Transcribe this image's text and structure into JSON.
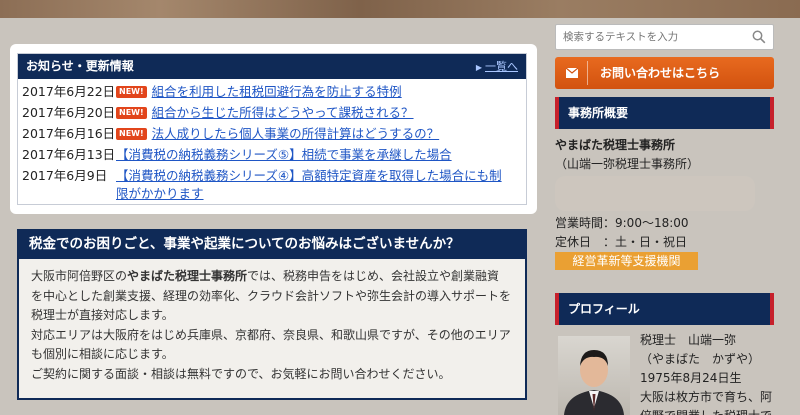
{
  "news": {
    "title": "お知らせ・更新情報",
    "more_label": "一覧へ",
    "new_badge": "NEW!",
    "items": [
      {
        "date": "2017年6月22日",
        "is_new": true,
        "title": "組合を利用した租税回避行為を防止する特例"
      },
      {
        "date": "2017年6月20日",
        "is_new": true,
        "title": "組合から生じた所得はどうやって課税される？"
      },
      {
        "date": "2017年6月16日",
        "is_new": true,
        "title": "法人成りしたら個人事業の所得計算はどうするの？"
      },
      {
        "date": "2017年6月13日",
        "is_new": false,
        "title": "【消費税の納税義務シリーズ⑤】相続で事業を承継した場合"
      },
      {
        "date": "2017年6月9日",
        "is_new": false,
        "title": "【消費税の納税義務シリーズ④】高額特定資産を取得した場合にも制限がかかります"
      }
    ]
  },
  "consult": {
    "heading": "税金でのお困りごと、事業や起業についてのお悩みはございませんか？",
    "p1_prefix": "大阪市阿倍野区の",
    "p1_bold": "やまばた税理士事務所",
    "p1_rest": "では、税務申告をはじめ、会社設立や創業融資を中心とした創業支援、経理の効率化、クラウド会計ソフトや弥生会計の導入サポートを税理士が直接対応します。",
    "p2": "対応エリアは大阪府をはじめ兵庫県、京都府、奈良県、和歌山県ですが、その他のエリアも個別に相談に応じます。",
    "p3": "ご契約に関する面談・相談は無料ですので、お気軽にお問い合わせください。"
  },
  "sidebar": {
    "search_placeholder": "検索するテキストを入力",
    "contact_label": "お問い合わせはこちら",
    "office_heading": "事務所概要",
    "office_name": "やまばた税理士事務所",
    "office_sub": "（山端一弥税理士事務所）",
    "hours": "営業時間：9:00〜18:00",
    "holidays": "定休日　：土・日・祝日",
    "support_label": "経営革新等支援機関",
    "profile_heading": "プロフィール",
    "profile_lines": [
      "税理士　山端一弥",
      "（やまばた　かずや）",
      "1975年8月24日生",
      "大阪は枚方市で育ち、阿",
      "倍野で開業した税理士で"
    ]
  },
  "colors": {
    "navy": "#0f2a57",
    "accent_orange": "#d9581a",
    "badge_red": "#e2451b",
    "link_blue": "#1f56c5",
    "support_orange": "#eaa033",
    "side_red": "#c6202b"
  }
}
